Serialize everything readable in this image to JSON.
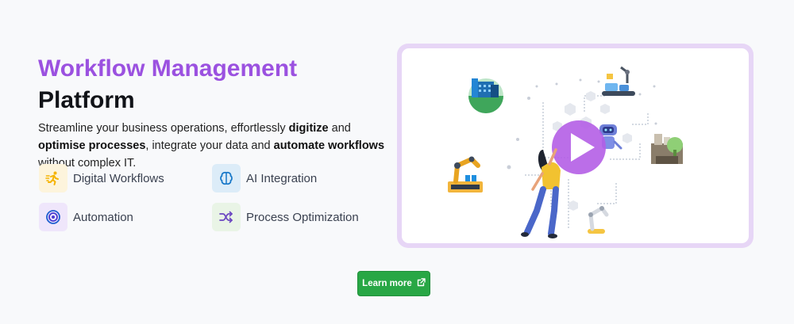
{
  "hero": {
    "title_accent": "Workflow Management",
    "title_main": "Platform",
    "description": {
      "p1": "Streamline your business operations, effortlessly ",
      "b1": "digitize",
      "p2": " and ",
      "b2": "optimise processes",
      "p3": ", integrate your data and ",
      "b3": "automate workflows",
      "p4": " without complex IT."
    }
  },
  "features": [
    {
      "label": "Digital Workflows",
      "icon": "running-person-icon",
      "color": "#f5b301",
      "bg": "#fdf4dc"
    },
    {
      "label": "AI Integration",
      "icon": "brain-icon",
      "color": "#1677c8",
      "bg": "#dcecf8"
    },
    {
      "label": "Automation",
      "icon": "target-icon",
      "color": "#4a3bd1",
      "bg": "#efe6fb"
    },
    {
      "label": "Process Optimization",
      "icon": "shuffle-icon",
      "color": "#6b46c1",
      "bg": "#e9f4e6"
    }
  ],
  "video": {
    "icon": "play-icon",
    "accent": "#b45ee6"
  },
  "cta": {
    "label": "Learn more",
    "icon": "external-link-icon",
    "color": "#28a745"
  }
}
